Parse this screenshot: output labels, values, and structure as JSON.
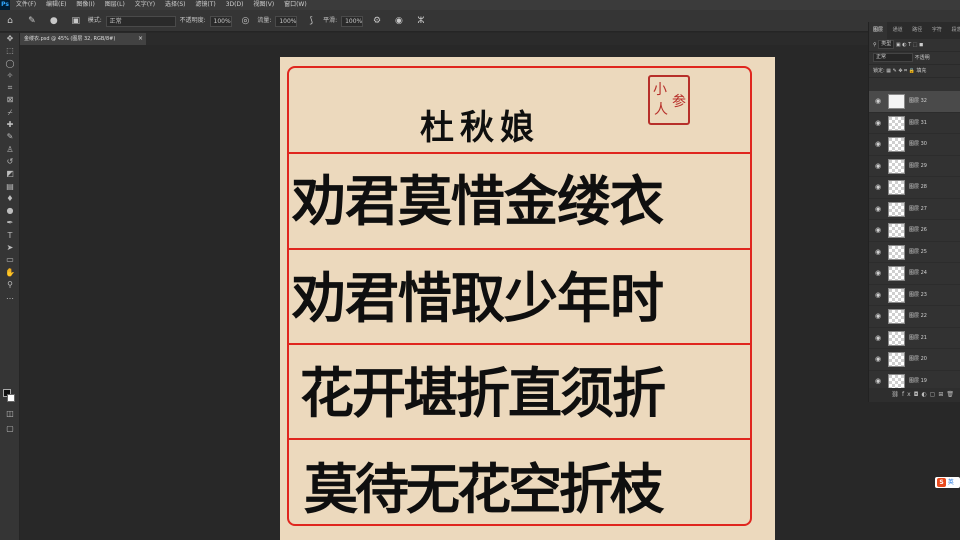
{
  "menubar": {
    "logo": "Ps",
    "items": [
      "文件(F)",
      "编辑(E)",
      "图像(I)",
      "图层(L)",
      "文字(Y)",
      "选择(S)",
      "滤镜(T)",
      "3D(D)",
      "视图(V)",
      "窗口(W)"
    ]
  },
  "options": {
    "mode_label": "模式:",
    "mode_value": "正常",
    "opacity_label": "不透明度:",
    "opacity_value": "100%",
    "flow_label": "流量:",
    "flow_value": "100%",
    "smooth_label": "平滑:",
    "smooth_value": "100%"
  },
  "document": {
    "tab_title": "金缕衣.psd @ 45% (图层 32, RGB/8#)",
    "close_glyph": "×"
  },
  "artwork": {
    "title": "杜秋娘",
    "seal": [
      "小",
      "人",
      "参"
    ],
    "lines": [
      "劝君莫惜金缕衣",
      "劝君惜取少年时",
      "花开堪折直须折",
      "莫待无花空折枝"
    ]
  },
  "layers_panel": {
    "tabs": [
      "图层",
      "通道",
      "路径",
      "字符",
      "段落"
    ],
    "filter_value": "类型",
    "blend_value": "正常",
    "opacity_label": "不透明",
    "lock_label": "锁定:",
    "fill_label": "填充",
    "layers": [
      "图层 32",
      "图层 31",
      "图层 30",
      "图层 29",
      "图层 28",
      "图层 27",
      "图层 26",
      "图层 25",
      "图层 24",
      "图层 23",
      "图层 22",
      "图层 21",
      "图层 20",
      "图层 19"
    ]
  },
  "ime_badge": {
    "icon": "S",
    "text": "英"
  },
  "colors": {
    "accent_red": "#e0261e",
    "paper": "#ecd9bd",
    "ink": "#0f0f0f"
  }
}
